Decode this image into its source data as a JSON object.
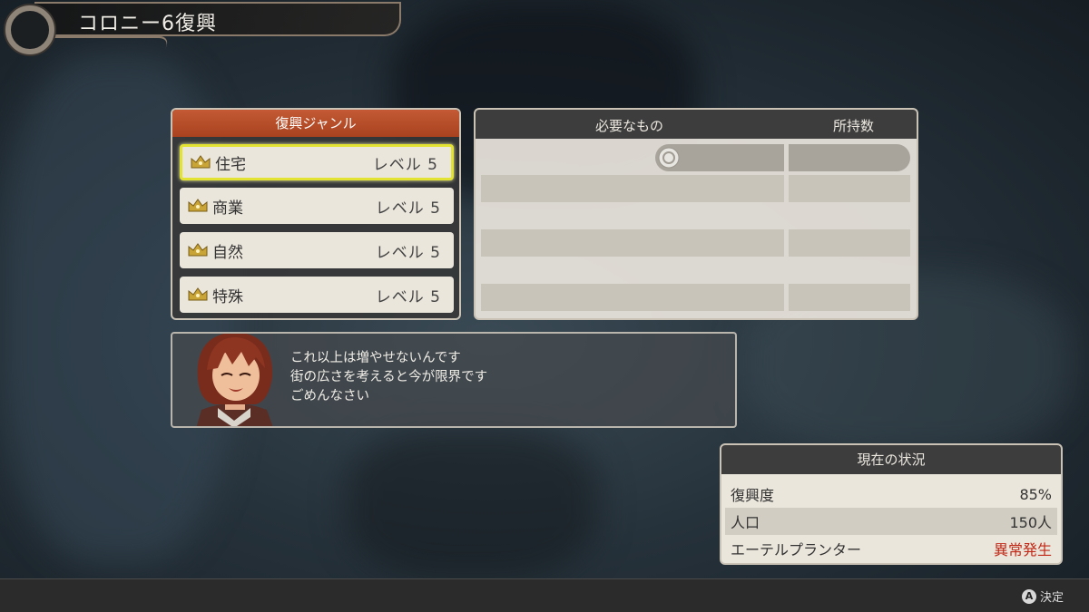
{
  "header": {
    "title": "コロニー6復興"
  },
  "genre_panel": {
    "title": "復興ジャンル",
    "items": [
      {
        "name": "住宅",
        "level": "レベル 5",
        "selected": true
      },
      {
        "name": "商業",
        "level": "レベル 5",
        "selected": false
      },
      {
        "name": "自然",
        "level": "レベル 5",
        "selected": false
      },
      {
        "name": "特殊",
        "level": "レベル 5",
        "selected": false
      }
    ]
  },
  "needs_panel": {
    "col_required": "必要なもの",
    "col_owned": "所持数"
  },
  "dialogue": {
    "lines": [
      "これ以上は増やせないんです",
      "街の広さを考えると今が限界です",
      "ごめんなさい"
    ]
  },
  "status_panel": {
    "title": "現在の状況",
    "rows": [
      {
        "label": "復興度",
        "value": "85%"
      },
      {
        "label": "人口",
        "value": "150人"
      },
      {
        "label": "エーテルプランター",
        "value": "異常発生"
      }
    ]
  },
  "footer": {
    "button_glyph": "A",
    "confirm_label": "決定"
  },
  "colors": {
    "genre_header": "#b34c27",
    "selected_border": "#e3e334",
    "alert": "#c02a18"
  }
}
